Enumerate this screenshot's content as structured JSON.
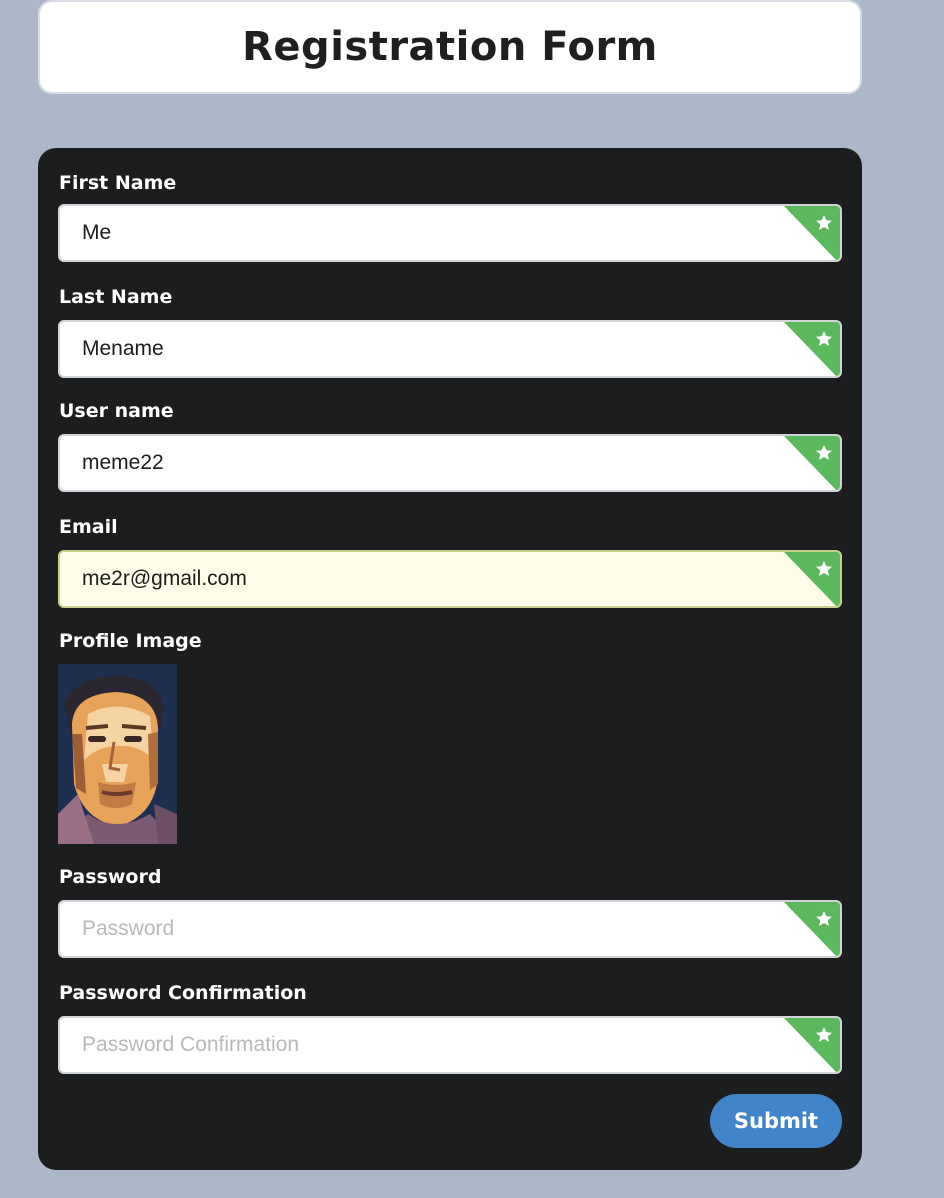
{
  "header": {
    "title": "Registration Form"
  },
  "form": {
    "first_name": {
      "label": "First Name",
      "value": "Me"
    },
    "last_name": {
      "label": "Last Name",
      "value": "Mename"
    },
    "username": {
      "label": "User name",
      "value": "meme22"
    },
    "email": {
      "label": "Email",
      "value": "me2r@gmail.com"
    },
    "profile_image": {
      "label": "Profile Image"
    },
    "password": {
      "label": "Password",
      "placeholder": "Password"
    },
    "password_confirmation": {
      "label": "Password Confirmation",
      "placeholder": "Password Confirmation"
    },
    "submit_label": "Submit"
  },
  "colors": {
    "page_background": "#acb8c9",
    "form_background": "#1c1d1f",
    "required_indicator": "#5cb85c",
    "submit_button": "#4284c9",
    "autofill_background": "#fdfde8"
  },
  "icons": {
    "required": "star-icon"
  }
}
